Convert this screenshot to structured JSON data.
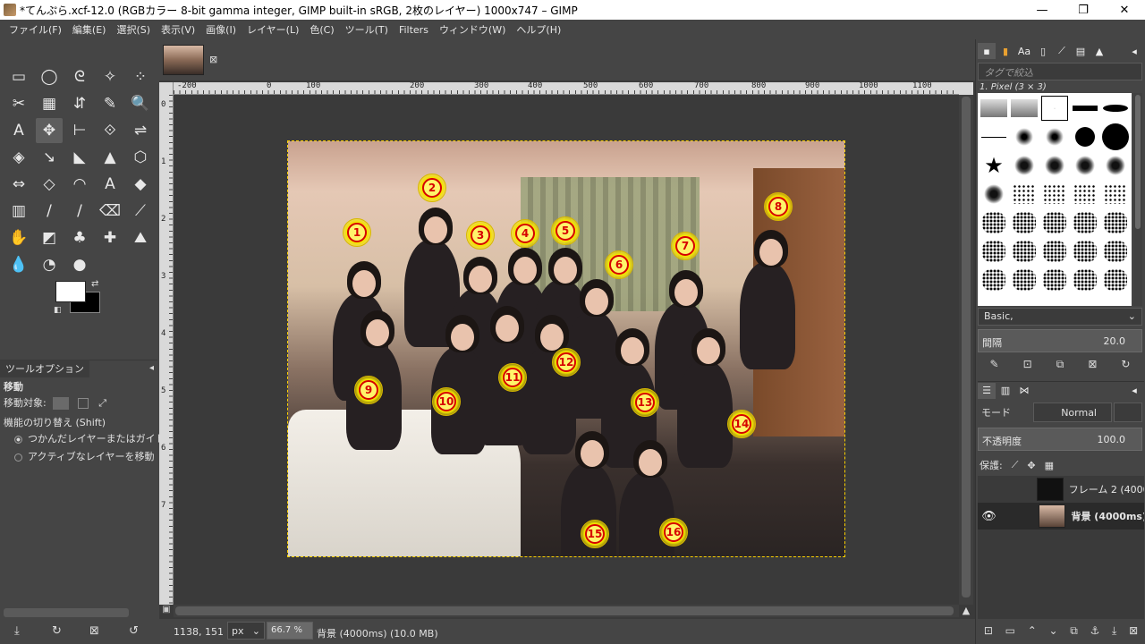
{
  "window": {
    "title": "*てんぷら.xcf-12.0 (RGBカラー 8-bit gamma integer, GIMP built-in sRGB, 2枚のレイヤー) 1000x747 – GIMP",
    "minimize": "—",
    "maximize": "❐",
    "close": "✕"
  },
  "menu": [
    "ファイル(F)",
    "編集(E)",
    "選択(S)",
    "表示(V)",
    "画像(I)",
    "レイヤー(L)",
    "色(C)",
    "ツール(T)",
    "Filters",
    "ウィンドウ(W)",
    "ヘルプ(H)"
  ],
  "tools": [
    [
      "▭",
      "◯",
      "ᘓ",
      "✧",
      "⁘"
    ],
    [
      "✂",
      "▦",
      "⇵",
      "✎",
      "🔍"
    ],
    [
      "A",
      "✥",
      "⊢",
      "⟐",
      "⇌"
    ],
    [
      "◈",
      "↘",
      "◣",
      "▲",
      "⬡"
    ],
    [
      "⇔",
      "◇",
      "◠",
      "A",
      "◆"
    ],
    [
      "▥",
      "/",
      "/",
      "⌫",
      "⟋"
    ],
    [
      "✋",
      "◩",
      "♣",
      "✚",
      "⛰"
    ],
    [
      "💧",
      "◔",
      "●"
    ]
  ],
  "tool_options": {
    "tab_label": "ツールオプション",
    "title": "移動",
    "move_target_label": "移動対象:",
    "toggle_label": "機能の切り替え (Shift)",
    "option1": "つかんだレイヤーまたはガイド",
    "option2": "アクティブなレイヤーを移動"
  },
  "ruler_h": [
    "-200",
    "0",
    "100",
    "200",
    "300",
    "400",
    "500",
    "600",
    "700",
    "800",
    "900",
    "1000",
    "1100"
  ],
  "ruler_v": [
    "0",
    "1",
    "2",
    "3",
    "4",
    "5",
    "6",
    "7"
  ],
  "badges": [
    "1",
    "2",
    "3",
    "4",
    "5",
    "6",
    "7",
    "8",
    "9",
    "10",
    "11",
    "12",
    "13",
    "14",
    "15",
    "16"
  ],
  "status": {
    "coords": "1138, 151",
    "unit": "px",
    "zoom": "66.7 %",
    "message": "背景 (4000ms) (10.0 MB)"
  },
  "brushes": {
    "tag_placeholder": "タグで絞込",
    "current_name": "1. Pixel (3 × 3)",
    "preset": "Basic,",
    "spacing_label": "間隔",
    "spacing_value": "20.0"
  },
  "layers": {
    "mode_label": "モード",
    "mode_value": "Normal",
    "opacity_label": "不透明度",
    "opacity_value": "100.0",
    "lock_label": "保護:",
    "items": [
      {
        "name": "フレーム 2 (4000",
        "visible": false
      },
      {
        "name": "背景 (4000ms)",
        "visible": true
      }
    ]
  },
  "colors": {
    "ui_bg": "#454545",
    "selection": "#ffd200",
    "badge_fill": "#f5e400",
    "badge_text": "#d60000"
  }
}
